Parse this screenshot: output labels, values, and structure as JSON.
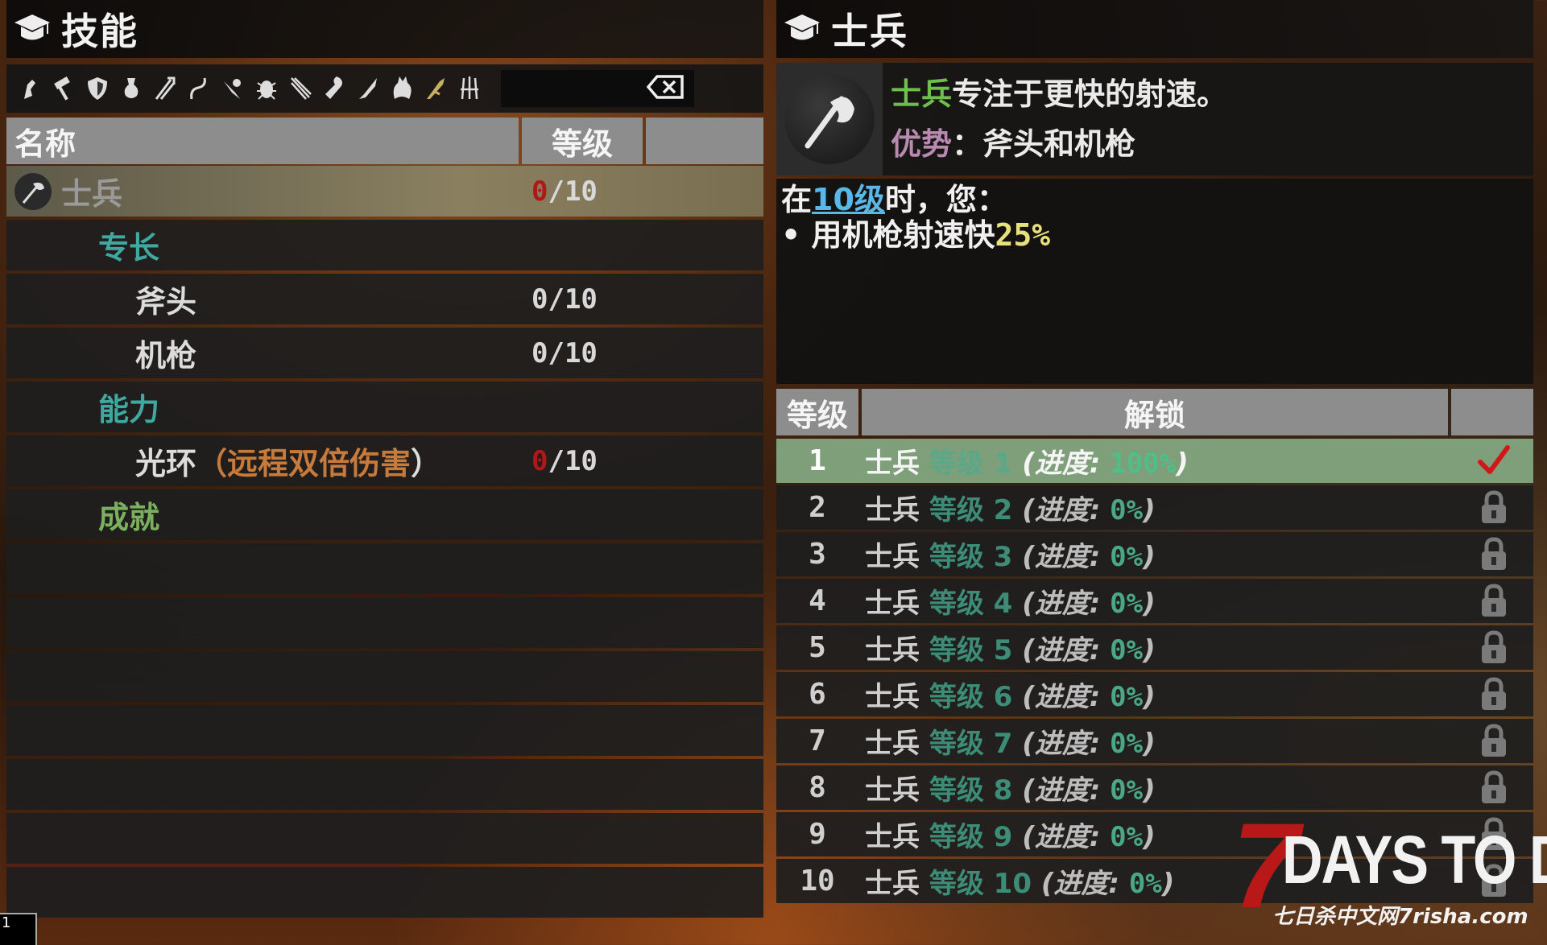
{
  "left": {
    "title": "技能",
    "category_icons": [
      "fist-icon",
      "hammer-icon",
      "shield-icon",
      "flask-icon",
      "spear-icon",
      "whip-icon",
      "bow-icon",
      "bug-icon",
      "blade-icon",
      "wrench-icon",
      "knife-icon",
      "wolf-icon",
      "gun-icon",
      "claw-icon"
    ],
    "header": {
      "name": "名称",
      "level": "等级"
    },
    "rows": [
      {
        "type": "selected",
        "name": "士兵",
        "level_current": "0",
        "level_max": "/10"
      },
      {
        "type": "category",
        "name": "专长"
      },
      {
        "type": "item",
        "name": "斧头",
        "level_current": "0",
        "level_max": "/10"
      },
      {
        "type": "item",
        "name": "机枪",
        "level_current": "0",
        "level_max": "/10"
      },
      {
        "type": "category",
        "name": "能力"
      },
      {
        "type": "ability",
        "name_prefix": "光环",
        "name_paren_open": "（",
        "name_inner": "远程双倍伤害",
        "name_paren_close": "）",
        "level_current": "0",
        "level_max": "/10"
      },
      {
        "type": "category_green",
        "name": "成就"
      }
    ]
  },
  "right": {
    "title": "士兵",
    "info": {
      "line1_highlight": "士兵",
      "line1_rest": "专注于更快的射速。",
      "line2_label": "优势",
      "line2_rest": "：斧头和机枪"
    },
    "desc": {
      "line1_pre": "在",
      "line1_link": "10级",
      "line1_post": "时，您：",
      "line2_pre": "• 用机枪射速快",
      "line2_value": "25%"
    },
    "header": {
      "level": "等级",
      "unlock": "解锁"
    },
    "unlocks": [
      {
        "num": "1",
        "name": "士兵",
        "lvtxt": "等级 1",
        "prog_label": "(进度: ",
        "prog_value": "100%",
        "close": ")",
        "done": true
      },
      {
        "num": "2",
        "name": "士兵",
        "lvtxt": "等级 2",
        "prog_label": "(进度: ",
        "prog_value": "0%",
        "close": ")",
        "done": false
      },
      {
        "num": "3",
        "name": "士兵",
        "lvtxt": "等级 3",
        "prog_label": "(进度: ",
        "prog_value": "0%",
        "close": ")",
        "done": false
      },
      {
        "num": "4",
        "name": "士兵",
        "lvtxt": "等级 4",
        "prog_label": "(进度: ",
        "prog_value": "0%",
        "close": ")",
        "done": false
      },
      {
        "num": "5",
        "name": "士兵",
        "lvtxt": "等级 5",
        "prog_label": "(进度: ",
        "prog_value": "0%",
        "close": ")",
        "done": false
      },
      {
        "num": "6",
        "name": "士兵",
        "lvtxt": "等级 6",
        "prog_label": "(进度: ",
        "prog_value": "0%",
        "close": ")",
        "done": false
      },
      {
        "num": "7",
        "name": "士兵",
        "lvtxt": "等级 7",
        "prog_label": "(进度: ",
        "prog_value": "0%",
        "close": ")",
        "done": false
      },
      {
        "num": "8",
        "name": "士兵",
        "lvtxt": "等级 8",
        "prog_label": "(进度: ",
        "prog_value": "0%",
        "close": ")",
        "done": false
      },
      {
        "num": "9",
        "name": "士兵",
        "lvtxt": "等级 9",
        "prog_label": "(进度: ",
        "prog_value": "0%",
        "close": ")",
        "done": false
      },
      {
        "num": "10",
        "name": "士兵",
        "lvtxt": "等级 10",
        "prog_label": "(进度: ",
        "prog_value": "0%",
        "close": ")",
        "done": false
      }
    ]
  },
  "watermark": {
    "seven": "7",
    "title": "DAYS TO DIE",
    "sub": "七日杀中文网7risha.com"
  },
  "corner": "1",
  "colors": {
    "selected_row": "#8a8060",
    "done_row": "#7f9e7a",
    "teal": "#3fa8a0",
    "green": "#7bb060",
    "red": "#b01818",
    "check_red": "#d01818"
  }
}
